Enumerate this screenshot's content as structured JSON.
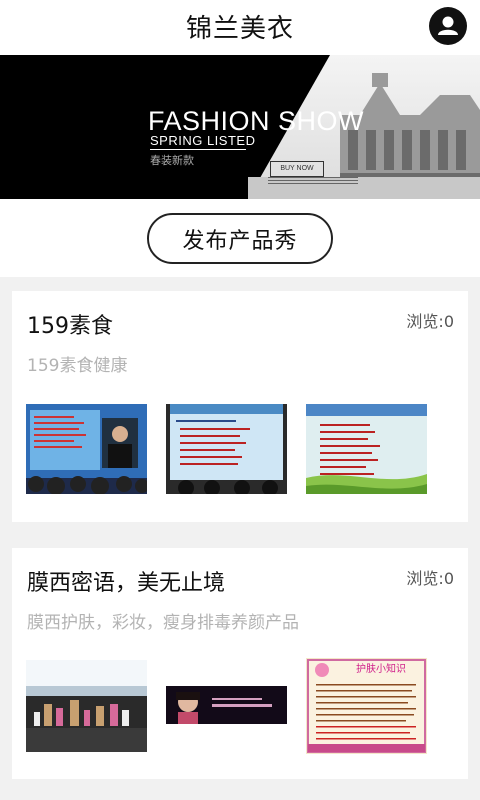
{
  "header": {
    "title": "锦兰美衣",
    "avatar_icon": "user-icon"
  },
  "banner": {
    "headline": "FASHION SHOW",
    "subline": "SPRING LISTED",
    "chinese": "春装新款",
    "button": "BUY NOW"
  },
  "publish_button": "发布产品秀",
  "posts": [
    {
      "title": "159素食",
      "views": "浏览:0",
      "description": "159素食健康"
    },
    {
      "title": "膜西密语，美无止境",
      "views": "浏览:0",
      "description": "膜西护肤，彩妆，瘦身排毒养颜产品",
      "thumb3_caption": "护肤小知识"
    }
  ],
  "colors": {
    "header_bg": "#ffffff",
    "page_bg": "#f1f1f1",
    "banner_dark": "#000000",
    "accent": "#111111"
  }
}
